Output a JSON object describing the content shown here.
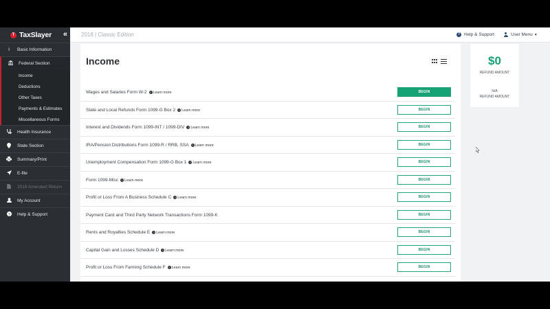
{
  "app": {
    "brand": "TaxSlayer",
    "edition": "2018 | Classic Edition"
  },
  "header": {
    "help_label": "Help & Support",
    "user_menu_label": "User Menu"
  },
  "sidebar": {
    "items": [
      {
        "label": "Basic Information",
        "icon": "info-icon"
      },
      {
        "label": "Federal Section",
        "icon": "bank-icon"
      },
      {
        "label": "Health Insurance",
        "icon": "stethoscope-icon"
      },
      {
        "label": "State Section",
        "icon": "map-pin-icon"
      },
      {
        "label": "Summary/Print",
        "icon": "printer-icon"
      },
      {
        "label": "E-file",
        "icon": "send-icon"
      },
      {
        "label": "2018 Amended Return",
        "icon": "document-icon"
      },
      {
        "label": "My Account",
        "icon": "user-icon"
      },
      {
        "label": "Help & Support",
        "icon": "question-icon"
      }
    ],
    "federal_sub": [
      "Income",
      "Deductions",
      "Other Taxes",
      "Payments & Estimates",
      "Miscellaneous Forms"
    ]
  },
  "main": {
    "title": "Income",
    "learn_more": "Learn more",
    "rows": [
      {
        "label": "Wages and Salaries Form W-2",
        "learn": true,
        "button": "BEGIN"
      },
      {
        "label": "State and Local Refunds Form 1099-G Box 2",
        "learn": true,
        "button": "BEGIN"
      },
      {
        "label": "Interest and Dividends Form 1099-INT / 1099-DIV",
        "learn": true,
        "button": "BEGIN"
      },
      {
        "label": "IRA/Pension Distributions Form 1099-R / RRB, SSA",
        "learn": true,
        "button": "BEGIN"
      },
      {
        "label": "Unemployment Compensation Form 1099-G Box 1",
        "learn": true,
        "button": "BEGIN"
      },
      {
        "label": "Form 1099-Misc",
        "learn": true,
        "button": "BEGIN"
      },
      {
        "label": "Profit or Loss From A Business Schedule C",
        "learn": true,
        "button": "BEGIN"
      },
      {
        "label": "Payment Card and Third Party Network Transactions Form 1099-K",
        "learn": false,
        "button": "BEGIN"
      },
      {
        "label": "Rents and Royalties Schedule E",
        "learn": true,
        "button": "BEGIN"
      },
      {
        "label": "Capital Gain and Losses Schedule D",
        "learn": true,
        "button": "BEGIN"
      },
      {
        "label": "Profit or Loss From Farming Schedule F",
        "learn": true,
        "button": "BEGIN"
      }
    ]
  },
  "refund": {
    "amount": "$0",
    "label": "REFUND AMOUNT",
    "state_value": "N/A",
    "state_label": "REFUND AMOUNT"
  },
  "colors": {
    "sidebar_bg": "#2b2f33",
    "accent_red": "#c8202d",
    "begin_green": "#17a276"
  }
}
